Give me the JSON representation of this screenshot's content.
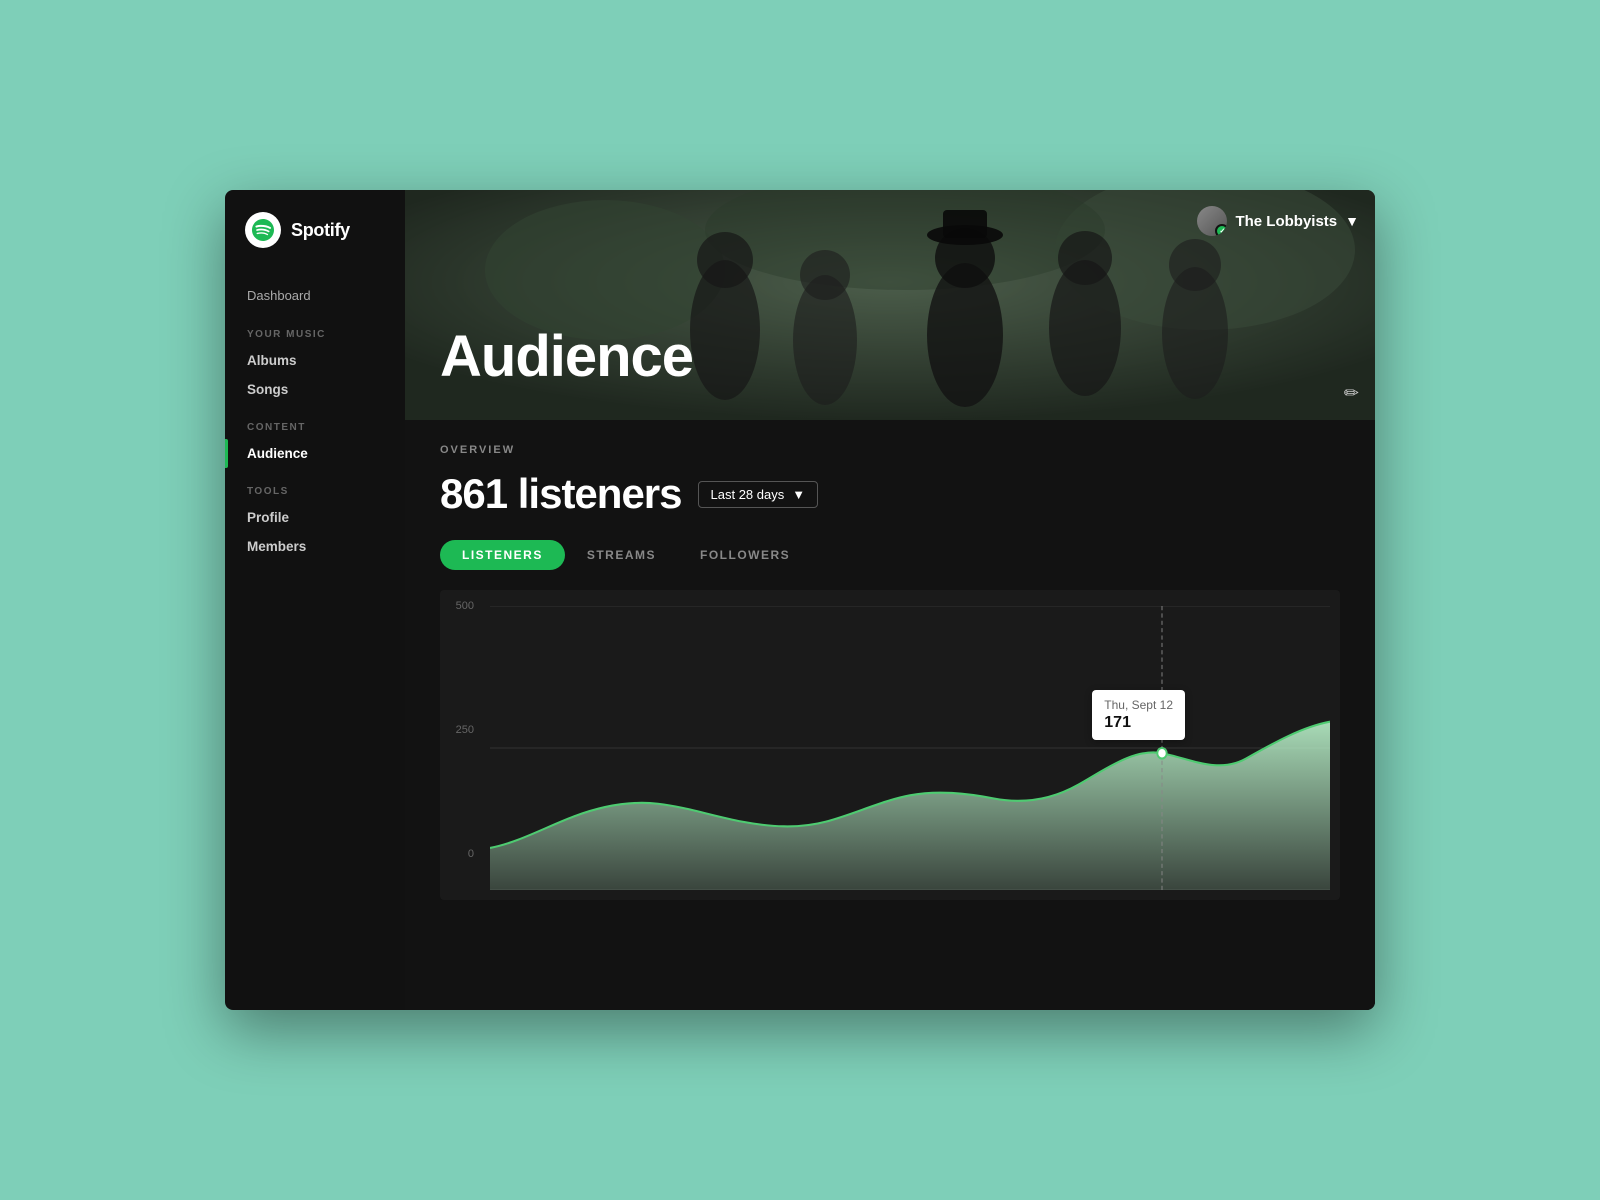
{
  "app": {
    "name": "Spotify",
    "logo_alt": "Spotify Logo"
  },
  "sidebar": {
    "dashboard_label": "Dashboard",
    "sections": [
      {
        "label": "YOUR MUSIC",
        "items": [
          {
            "id": "albums",
            "label": "Albums",
            "active": false
          },
          {
            "id": "songs",
            "label": "Songs",
            "active": false
          }
        ]
      },
      {
        "label": "CONTENT",
        "items": [
          {
            "id": "audience",
            "label": "Audience",
            "active": true
          }
        ]
      },
      {
        "label": "TOOLS",
        "items": [
          {
            "id": "profile",
            "label": "Profile",
            "active": false
          },
          {
            "id": "members",
            "label": "Members",
            "active": false
          }
        ]
      }
    ]
  },
  "hero": {
    "title": "Audience",
    "band_name": "The Lobbyists"
  },
  "overview": {
    "label": "OVERVIEW",
    "listeners_count": "861 listeners",
    "date_filter": "Last 28 days",
    "tabs": [
      {
        "id": "listeners",
        "label": "LISTENERS",
        "active": true
      },
      {
        "id": "streams",
        "label": "STREAMS",
        "active": false
      },
      {
        "id": "followers",
        "label": "FOLLOWERS",
        "active": false
      }
    ]
  },
  "chart": {
    "y_labels": [
      "500",
      "250",
      "0"
    ],
    "tooltip": {
      "date": "Thu, Sept 12",
      "value": "171"
    }
  }
}
